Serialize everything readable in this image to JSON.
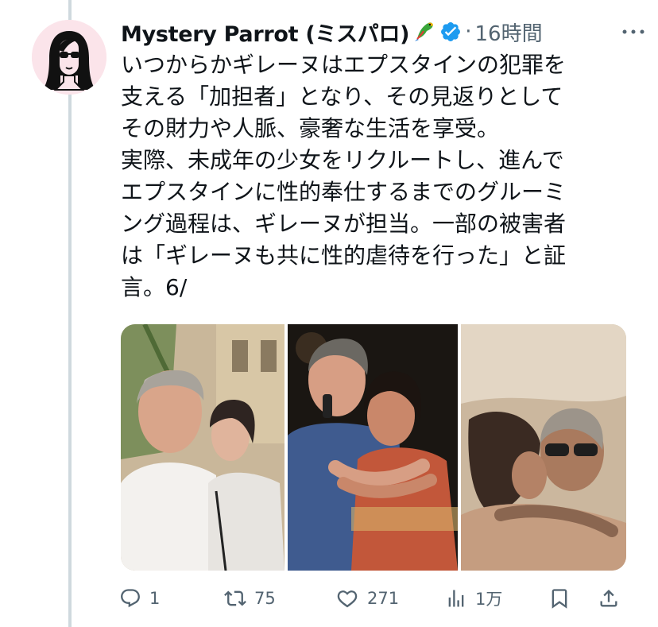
{
  "tweet": {
    "author_name": "Mystery Parrot (ミスパロ)",
    "author_emoji": "🦜",
    "separator": "·",
    "timestamp": "16時間",
    "text": "いつからかギレーヌはエプスタインの犯罪を\n支える「加担者」となり、その見返りとして\nその財力や人脈、豪奢な生活を享受。\n実際、未成年の少女をリクルートし、進んで\nエプスタインに性的奉仕するまでのグルーミ\nング過程は、ギレーヌが担当。一部の被害者\nは「ギレーヌも共に性的虐待を行った」と証\n言。6/"
  },
  "actions": {
    "reply_count": "1",
    "retweet_count": "75",
    "like_count": "271",
    "views_count": "1万"
  },
  "colors": {
    "text": "#0f1419",
    "muted": "#536471",
    "verified": "#1d9bf0",
    "thread_line": "#cfd9de"
  },
  "icons": [
    "more-icon",
    "verified-icon",
    "reply-icon",
    "retweet-icon",
    "like-icon",
    "views-icon",
    "bookmark-icon",
    "share-icon"
  ]
}
